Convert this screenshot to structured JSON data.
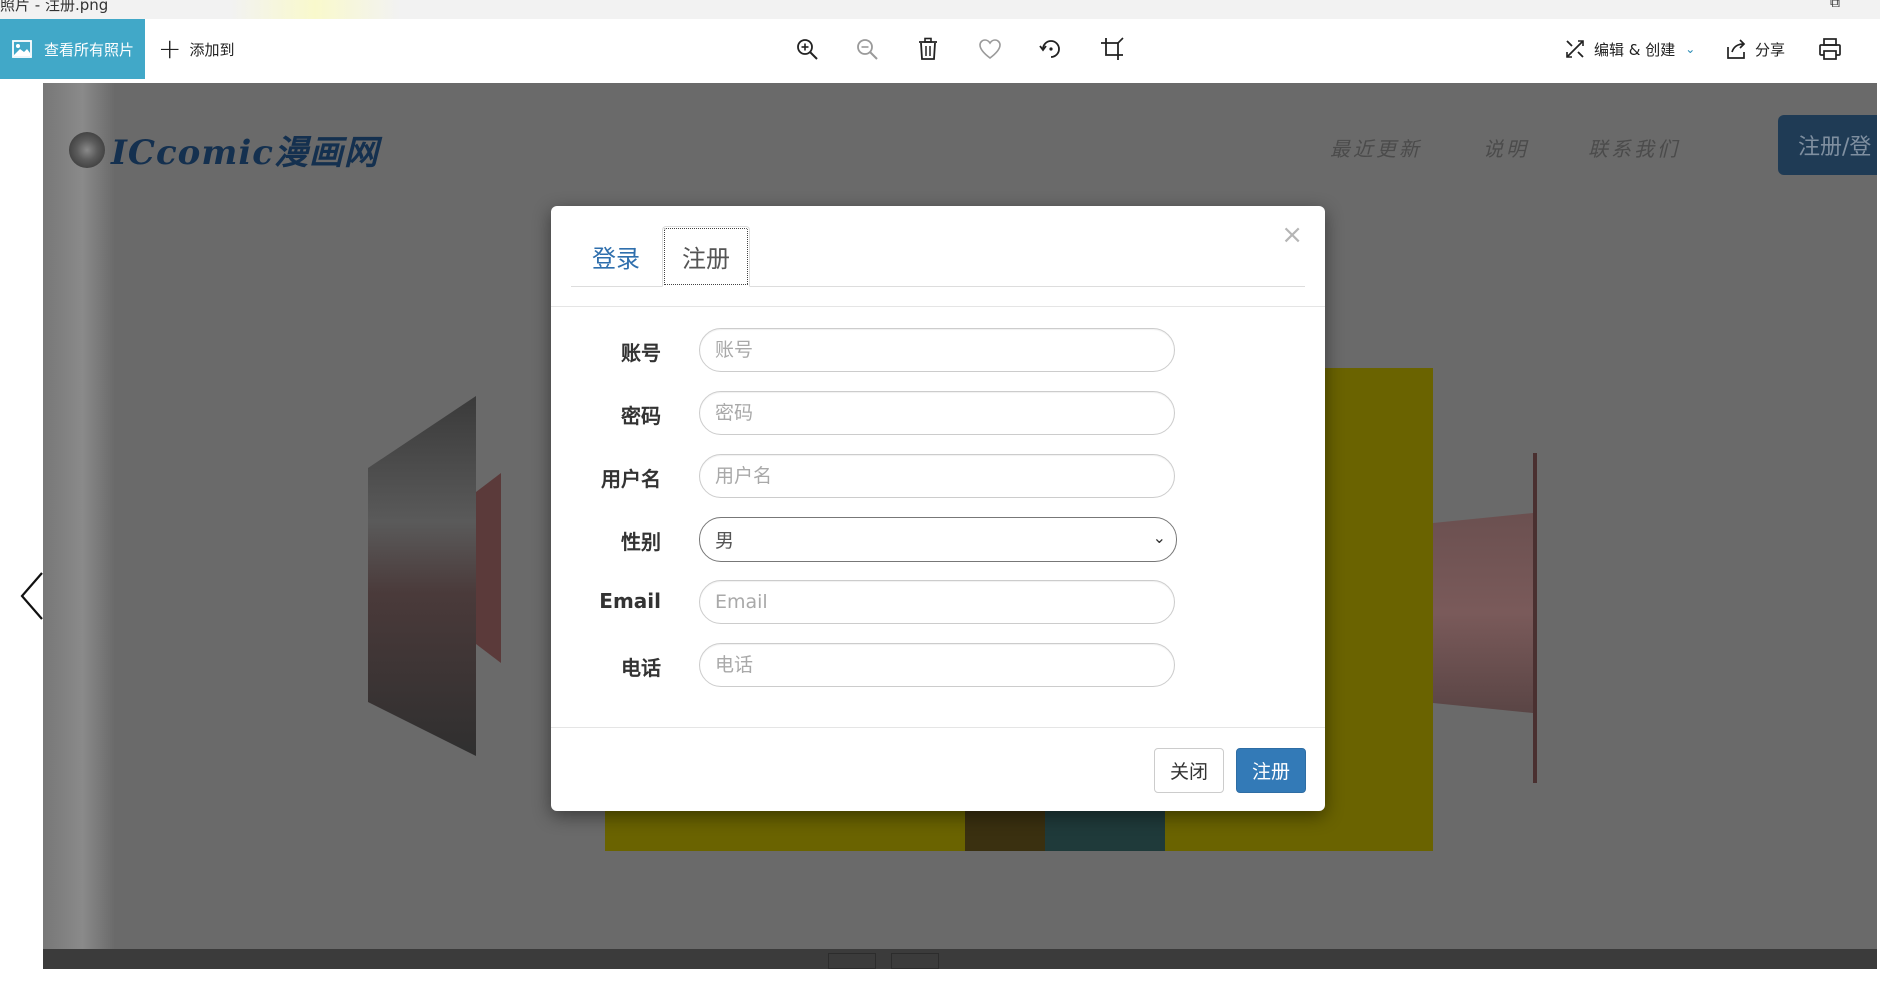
{
  "window": {
    "title": "照片 - 注册.png"
  },
  "toolbar": {
    "view_all_label": "查看所有照片",
    "add_to_label": "添加到",
    "edit_create_label": "编辑 & 创建",
    "share_label": "分享",
    "accent_color": "#41a8c8",
    "icons": [
      "zoom-in-icon",
      "zoom-out-icon",
      "delete-icon",
      "heart-icon",
      "rotate-icon",
      "crop-icon",
      "print-icon"
    ]
  },
  "site": {
    "logo_text": "ICcomic漫画网",
    "nav": [
      "最近更新",
      "说明",
      "联系我们"
    ],
    "register_button": "注册/登"
  },
  "modal": {
    "tabs": [
      {
        "label": "登录",
        "active": false
      },
      {
        "label": "注册",
        "active": true
      }
    ],
    "fields": [
      {
        "label": "账号",
        "placeholder": "账号"
      },
      {
        "label": "密码",
        "placeholder": "密码"
      },
      {
        "label": "用户名",
        "placeholder": "用户名"
      },
      {
        "label": "性别",
        "value": "男"
      },
      {
        "label": "Email",
        "placeholder": "Email"
      },
      {
        "label": "电话",
        "placeholder": "电话"
      }
    ],
    "close_button": "关闭",
    "submit_button": "注册",
    "primary_color": "#337ab7"
  }
}
